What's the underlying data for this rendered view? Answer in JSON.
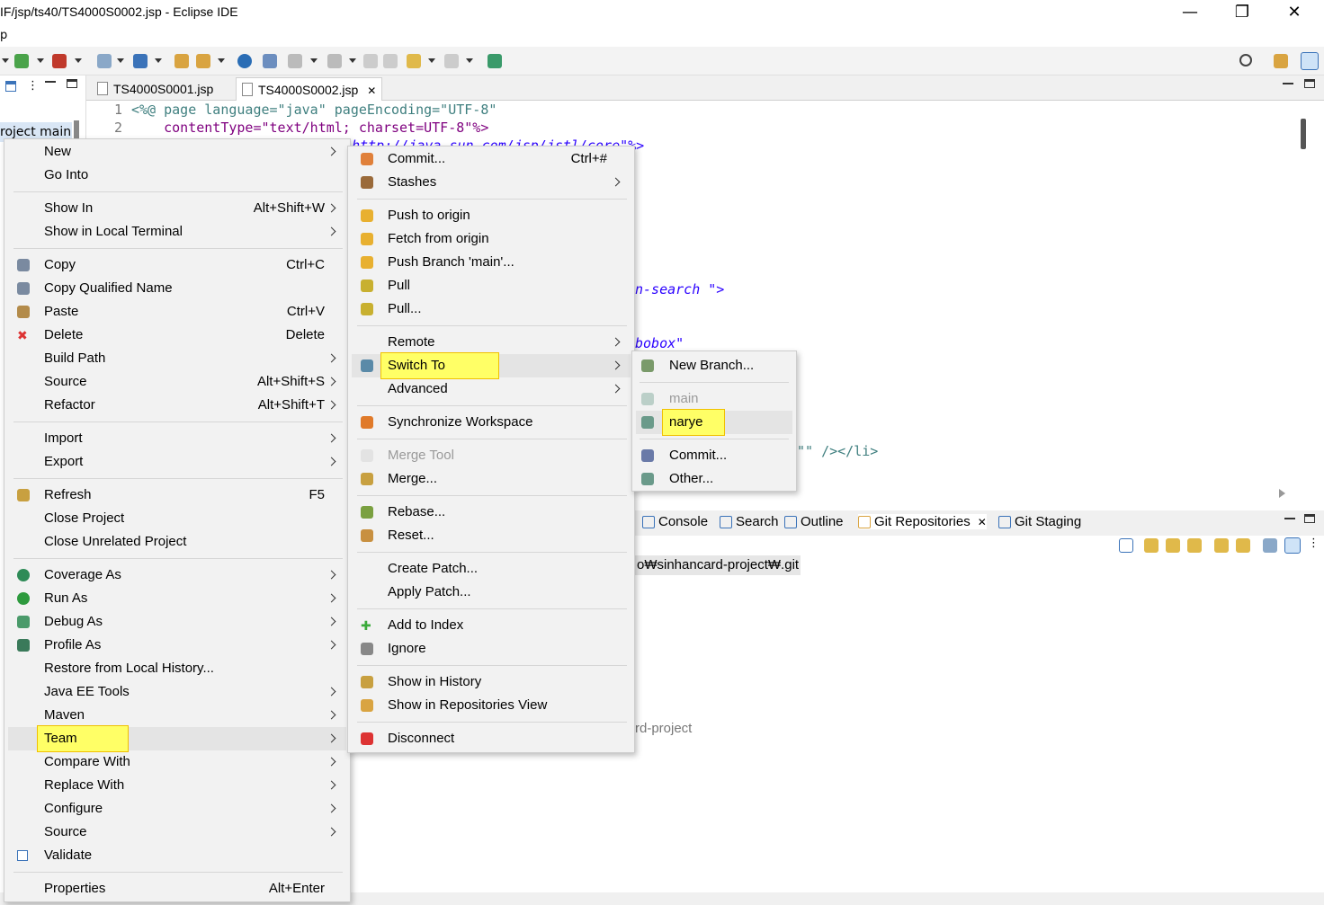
{
  "window": {
    "title": "IF/jsp/ts40/TS4000S0002.jsp - Eclipse IDE",
    "minimize": "—",
    "restore": "❐",
    "close": "✕"
  },
  "menubar": {
    "fragment": "p"
  },
  "left_pane": {
    "selected_item": "roject main"
  },
  "editor": {
    "tabs": [
      {
        "label": "TS4000S0001.jsp",
        "active": false
      },
      {
        "label": "TS4000S0002.jsp",
        "active": true,
        "close": "✕"
      }
    ],
    "lines": [
      {
        "num": "1",
        "text": "<%@ page language=\"java\" pageEncoding=\"UTF-8\""
      },
      {
        "num": "2",
        "text": "    contentType=\"text/html; charset=UTF-8\"%>"
      }
    ],
    "fragments": {
      "core": "i=\"http://java.sun.com/jsp/jstl/core\"%>",
      "search": "n-search \">",
      "combobox": "bobox\"",
      "li": "\"\" /></li>"
    }
  },
  "bottom_views": {
    "tabs": [
      {
        "label": "Console",
        "icon": "console-icon"
      },
      {
        "label": "Search",
        "icon": "search-icon"
      },
      {
        "label": "Outline",
        "icon": "outline-icon"
      },
      {
        "label": "Git Repositories",
        "icon": "git-repo-icon",
        "active": true,
        "close": "✕"
      },
      {
        "label": "Git Staging",
        "icon": "git-staging-icon"
      }
    ],
    "repo_path": "o₩sinhancard-project₩.git",
    "repo_tail": "rd-project"
  },
  "context_menu": {
    "items": [
      {
        "label": "New",
        "arrow": true
      },
      {
        "label": "Go Into"
      },
      {
        "sep": true
      },
      {
        "label": "Show In",
        "accel": "Alt+Shift+W",
        "arrow": true
      },
      {
        "label": "Show in Local Terminal",
        "arrow": true
      },
      {
        "sep": true
      },
      {
        "label": "Copy",
        "accel": "Ctrl+C",
        "icon": "copy-icon"
      },
      {
        "label": "Copy Qualified Name",
        "icon": "copy-qualified-icon"
      },
      {
        "label": "Paste",
        "accel": "Ctrl+V",
        "icon": "paste-icon"
      },
      {
        "label": "Delete",
        "accel": "Delete",
        "icon": "delete-icon"
      },
      {
        "label": "Build Path",
        "arrow": true
      },
      {
        "label": "Source",
        "accel": "Alt+Shift+S",
        "arrow": true
      },
      {
        "label": "Refactor",
        "accel": "Alt+Shift+T",
        "arrow": true
      },
      {
        "sep": true
      },
      {
        "label": "Import",
        "arrow": true
      },
      {
        "label": "Export",
        "arrow": true
      },
      {
        "sep": true
      },
      {
        "label": "Refresh",
        "accel": "F5",
        "icon": "refresh-icon"
      },
      {
        "label": "Close Project"
      },
      {
        "label": "Close Unrelated Project"
      },
      {
        "sep": true
      },
      {
        "label": "Coverage As",
        "arrow": true,
        "icon": "coverage-icon"
      },
      {
        "label": "Run As",
        "arrow": true,
        "icon": "run-icon"
      },
      {
        "label": "Debug As",
        "arrow": true,
        "icon": "debug-icon"
      },
      {
        "label": "Profile As",
        "arrow": true,
        "icon": "profile-icon"
      },
      {
        "label": "Restore from Local History..."
      },
      {
        "label": "Java EE Tools",
        "arrow": true
      },
      {
        "label": "Maven",
        "arrow": true
      },
      {
        "label": "Team",
        "arrow": true,
        "highlight": true
      },
      {
        "label": "Compare With",
        "arrow": true
      },
      {
        "label": "Replace With",
        "arrow": true
      },
      {
        "label": "Configure",
        "arrow": true
      },
      {
        "label": "Source",
        "arrow": true
      },
      {
        "label": "Validate",
        "icon": "validate-check-icon"
      },
      {
        "sep": true
      },
      {
        "label": "Properties",
        "accel": "Alt+Enter"
      }
    ]
  },
  "team_menu": {
    "items": [
      {
        "label": "Commit...",
        "accel": "Ctrl+#",
        "icon": "commit-icon"
      },
      {
        "label": "Stashes",
        "arrow": true,
        "icon": "stashes-icon"
      },
      {
        "sep": true
      },
      {
        "label": "Push to origin",
        "icon": "push-icon"
      },
      {
        "label": "Fetch from origin",
        "icon": "fetch-icon"
      },
      {
        "label": "Push Branch 'main'...",
        "icon": "push-branch-icon"
      },
      {
        "label": "Pull",
        "icon": "pull-icon"
      },
      {
        "label": "Pull...",
        "icon": "pull-dialog-icon"
      },
      {
        "sep": true
      },
      {
        "label": "Remote",
        "arrow": true
      },
      {
        "label": "Switch To",
        "arrow": true,
        "highlight": true,
        "icon": "switch-branch-icon"
      },
      {
        "label": "Advanced",
        "arrow": true
      },
      {
        "sep": true
      },
      {
        "label": "Synchronize Workspace",
        "icon": "synchronize-icon"
      },
      {
        "sep": true
      },
      {
        "label": "Merge Tool",
        "disabled": true,
        "icon": "merge-tool-icon"
      },
      {
        "label": "Merge...",
        "icon": "merge-icon"
      },
      {
        "sep": true
      },
      {
        "label": "Rebase...",
        "icon": "rebase-icon"
      },
      {
        "label": "Reset...",
        "icon": "reset-icon"
      },
      {
        "sep": true
      },
      {
        "label": "Create Patch..."
      },
      {
        "label": "Apply Patch..."
      },
      {
        "sep": true
      },
      {
        "label": "Add to Index",
        "icon": "add-to-index-icon"
      },
      {
        "label": "Ignore",
        "icon": "ignore-icon"
      },
      {
        "sep": true
      },
      {
        "label": "Show in History",
        "icon": "history-icon"
      },
      {
        "label": "Show in Repositories View",
        "icon": "repositories-view-icon"
      },
      {
        "sep": true
      },
      {
        "label": "Disconnect",
        "icon": "disconnect-icon"
      }
    ]
  },
  "switch_menu": {
    "items": [
      {
        "label": "New Branch...",
        "icon": "new-branch-icon"
      },
      {
        "sep": true
      },
      {
        "label": "main",
        "disabled": true,
        "icon": "branch-icon"
      },
      {
        "label": "narye",
        "highlight": true,
        "icon": "branch-icon"
      },
      {
        "sep": true
      },
      {
        "label": "Commit...",
        "icon": "commit-ref-icon"
      },
      {
        "label": "Other...",
        "icon": "other-branch-icon"
      }
    ]
  },
  "colors": {
    "accent": "#3b73b9",
    "highlight": "#ffff66",
    "menu_bg": "#f2f2f2",
    "editor_current_line": "#e8f2fe"
  }
}
